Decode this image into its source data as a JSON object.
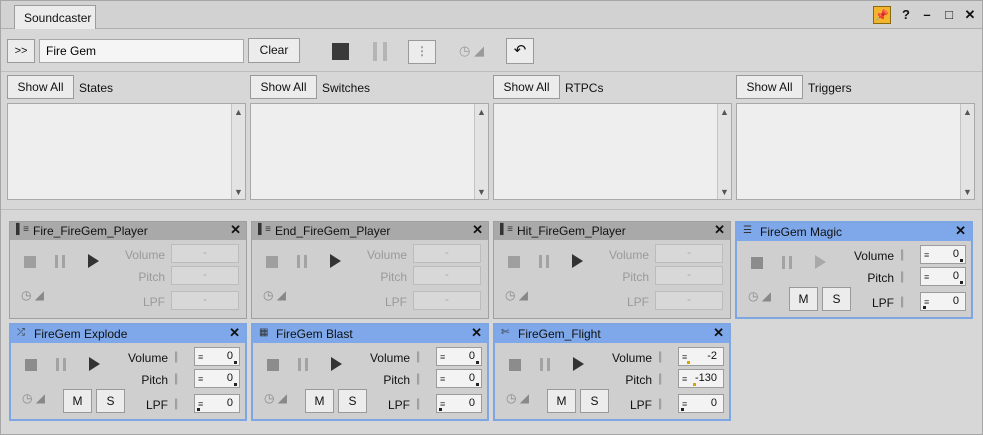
{
  "tab": {
    "label": "Soundcaster"
  },
  "toolbar": {
    "expand_label": ">>",
    "search_value": "Fire Gem",
    "clear_label": "Clear",
    "more_label": "⋮"
  },
  "filters": [
    {
      "button": "Show All",
      "label": "States"
    },
    {
      "button": "Show All",
      "label": "Switches"
    },
    {
      "button": "Show All",
      "label": "RTPCs"
    },
    {
      "button": "Show All",
      "label": "Triggers"
    }
  ],
  "cards": [
    {
      "title": "Fire_FireGem_Player",
      "active": false,
      "volume_label": "Volume",
      "pitch_label": "Pitch",
      "lpf_label": "LPF",
      "volume": "-",
      "pitch": "-",
      "lpf": "-"
    },
    {
      "title": "End_FireGem_Player",
      "active": false,
      "volume_label": "Volume",
      "pitch_label": "Pitch",
      "lpf_label": "LPF",
      "volume": "-",
      "pitch": "-",
      "lpf": "-"
    },
    {
      "title": "Hit_FireGem_Player",
      "active": false,
      "volume_label": "Volume",
      "pitch_label": "Pitch",
      "lpf_label": "LPF",
      "volume": "-",
      "pitch": "-",
      "lpf": "-"
    },
    {
      "title": "FireGem Magic",
      "active": true,
      "volume_label": "Volume",
      "pitch_label": "Pitch",
      "lpf_label": "LPF",
      "volume": "0",
      "pitch": "0",
      "lpf": "0",
      "m_label": "M",
      "s_label": "S"
    },
    {
      "title": "FireGem Explode",
      "active": true,
      "volume_label": "Volume",
      "pitch_label": "Pitch",
      "lpf_label": "LPF",
      "volume": "0",
      "pitch": "0",
      "lpf": "0",
      "m_label": "M",
      "s_label": "S"
    },
    {
      "title": "FireGem Blast",
      "active": true,
      "volume_label": "Volume",
      "pitch_label": "Pitch",
      "lpf_label": "LPF",
      "volume": "0",
      "pitch": "0",
      "lpf": "0",
      "m_label": "M",
      "s_label": "S"
    },
    {
      "title": "FireGem_Flight",
      "active": true,
      "volume_label": "Volume",
      "pitch_label": "Pitch",
      "lpf_label": "LPF",
      "volume": "-2",
      "pitch": "-130",
      "lpf": "0",
      "m_label": "M",
      "s_label": "S"
    }
  ],
  "colors": {
    "active_header": "#7ea8ea",
    "pin": "#f3b52c"
  }
}
